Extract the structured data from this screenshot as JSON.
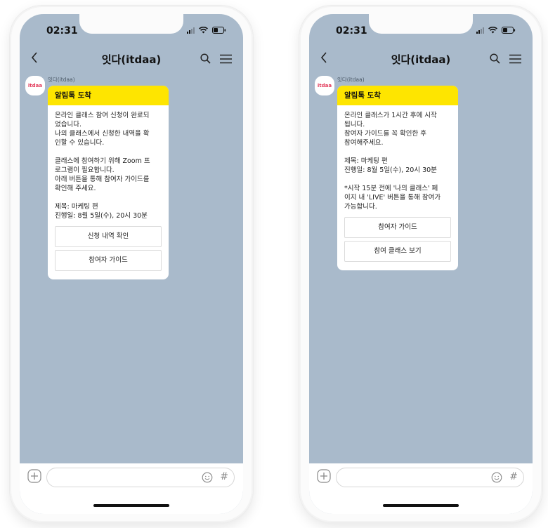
{
  "colors": {
    "chat_background": "#a9bacb",
    "header_yellow": "#fee500",
    "brand_red": "#e23a5a"
  },
  "phones": [
    {
      "status_time": "02:31",
      "chat_title": "잇다(itdaa)",
      "sender_name": "잇다(itdaa)",
      "avatar_label": "itdaa",
      "bubble_header": "알림톡 도착",
      "paragraphs": [
        "온라인 클래스 참여 신청이 완료되\n었습니다.\n나의 클래스에서 신청한 내역을 확\n인할 수 있습니다.",
        "클래스에 참여하기 위해 Zoom 프\n로그램이 필요합니다.\n아래 버튼을 통해 참여자 가이드를\n확인해 주세요.",
        "제목: 마케팅 편\n진행일: 8월 5일(수), 20시 30분"
      ],
      "buttons": [
        "신청 내역 확인",
        "참여자 가이드"
      ],
      "hash_symbol": "#"
    },
    {
      "status_time": "02:31",
      "chat_title": "잇다(itdaa)",
      "sender_name": "잇다(itdaa)",
      "avatar_label": "itdaa",
      "bubble_header": "알림톡 도착",
      "paragraphs": [
        "온라인 클래스가 1시간 후에 시작\n됩니다.\n참여자 가이드를 꼭 확인한 후\n참여해주세요.",
        "제목: 마케팅 편\n진행일: 8월 5일(수), 20시 30분",
        "*시작 15분 전에 '나의 클래스' 페\n이지 내 'LIVE' 버튼을 통해 참여가\n가능합니다."
      ],
      "buttons": [
        "참여자 가이드",
        "참여 클래스 보기"
      ],
      "hash_symbol": "#"
    }
  ]
}
